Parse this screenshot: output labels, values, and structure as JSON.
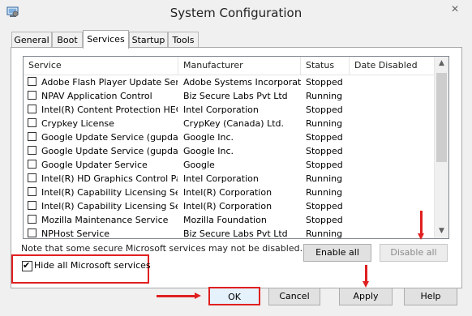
{
  "window": {
    "title": "System Configuration",
    "close_glyph": "✕"
  },
  "tabs": [
    "General",
    "Boot",
    "Services",
    "Startup",
    "Tools"
  ],
  "active_tab": "Services",
  "table": {
    "headers": [
      "Service",
      "Manufacturer",
      "Status",
      "Date Disabled"
    ],
    "rows": [
      {
        "name": "Adobe Flash Player Update Service",
        "manufacturer": "Adobe Systems Incorporated",
        "status": "Stopped",
        "date_disabled": ""
      },
      {
        "name": "NPAV Application Control",
        "manufacturer": "Biz Secure Labs Pvt Ltd",
        "status": "Running",
        "date_disabled": ""
      },
      {
        "name": "Intel(R) Content Protection HEC...",
        "manufacturer": "Intel Corporation",
        "status": "Stopped",
        "date_disabled": ""
      },
      {
        "name": "Crypkey License",
        "manufacturer": "CrypKey (Canada) Ltd.",
        "status": "Running",
        "date_disabled": ""
      },
      {
        "name": "Google Update Service (gupdate)",
        "manufacturer": "Google Inc.",
        "status": "Stopped",
        "date_disabled": ""
      },
      {
        "name": "Google Update Service (gupdatem)",
        "manufacturer": "Google Inc.",
        "status": "Stopped",
        "date_disabled": ""
      },
      {
        "name": "Google Updater Service",
        "manufacturer": "Google",
        "status": "Stopped",
        "date_disabled": ""
      },
      {
        "name": "Intel(R) HD Graphics Control Pa...",
        "manufacturer": "Intel Corporation",
        "status": "Running",
        "date_disabled": ""
      },
      {
        "name": "Intel(R) Capability Licensing Ser...",
        "manufacturer": "Intel(R) Corporation",
        "status": "Running",
        "date_disabled": ""
      },
      {
        "name": "Intel(R) Capability Licensing Ser...",
        "manufacturer": "Intel(R) Corporation",
        "status": "Stopped",
        "date_disabled": ""
      },
      {
        "name": "Mozilla Maintenance Service",
        "manufacturer": "Mozilla Foundation",
        "status": "Stopped",
        "date_disabled": ""
      },
      {
        "name": "NPHost Service",
        "manufacturer": "Biz Secure Labs Pvt Ltd",
        "status": "Running",
        "date_disabled": ""
      }
    ]
  },
  "scroll": {
    "up_glyph": "▲",
    "down_glyph": "▼"
  },
  "note": "Note that some secure Microsoft services may not be disabled.",
  "buttons": {
    "enable_all": "Enable all",
    "disable_all": "Disable all",
    "ok": "OK",
    "cancel": "Cancel",
    "apply": "Apply",
    "help": "Help"
  },
  "hide_ms": {
    "label": "Hide all Microsoft services",
    "checked": true,
    "check_glyph": "✔"
  },
  "colors": {
    "annotation_red": "#e02020",
    "panel_bg": "#f0f0f0"
  }
}
